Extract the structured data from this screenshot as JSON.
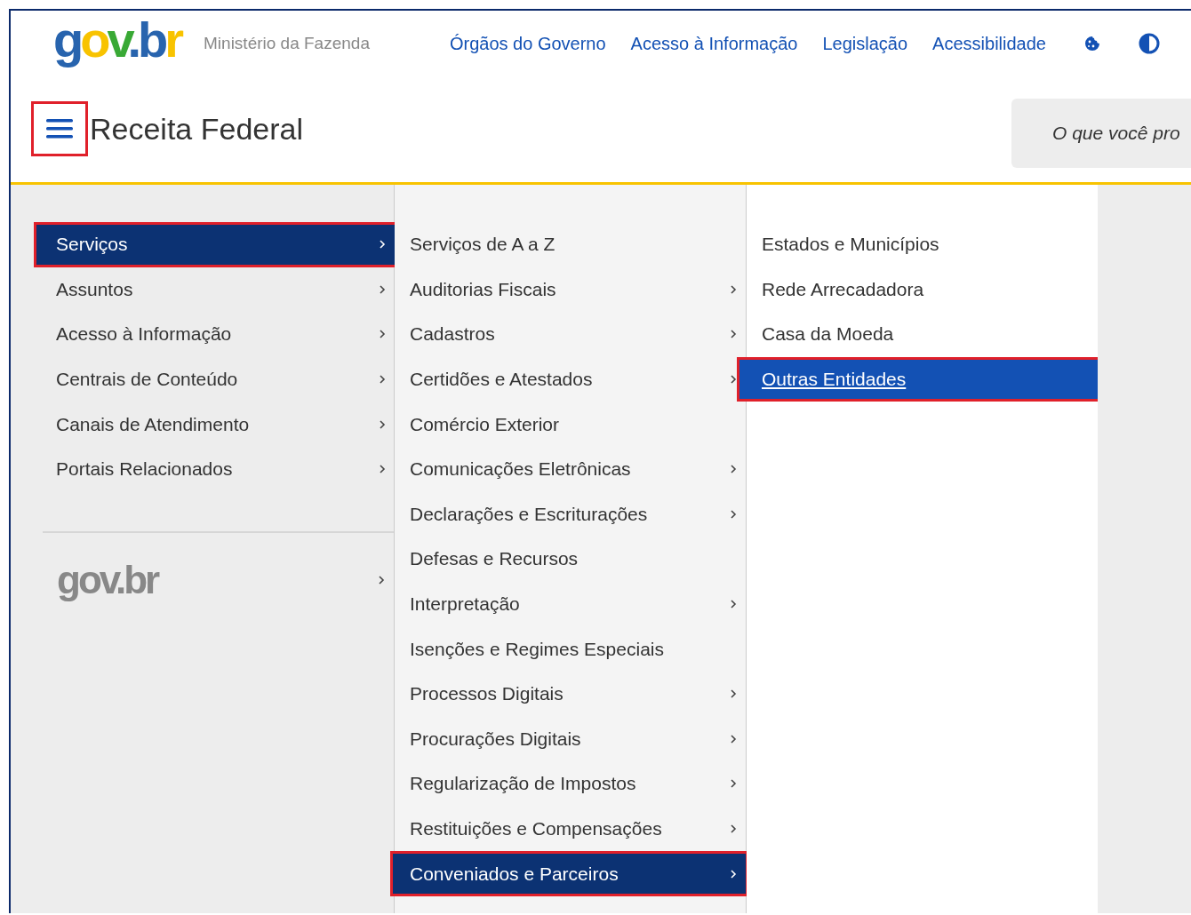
{
  "header": {
    "logo": "gov.br",
    "ministry": "Ministério da Fazenda",
    "nav_links": [
      "Órgãos do Governo",
      "Acesso à Informação",
      "Legislação",
      "Acessibilidade"
    ],
    "menu_button": {
      "highlighted": true
    },
    "site_title": "Receita Federal",
    "search": {
      "placeholder": "O que você pro"
    }
  },
  "menu_level_1": {
    "items": [
      {
        "label": "Serviços",
        "expandable": true,
        "selected": true,
        "highlighted": true
      },
      {
        "label": "Assuntos",
        "expandable": true,
        "selected": false,
        "highlighted": false
      },
      {
        "label": "Acesso à Informação",
        "expandable": true,
        "selected": false,
        "highlighted": false
      },
      {
        "label": "Centrais de Conteúdo",
        "expandable": true,
        "selected": false,
        "highlighted": false
      },
      {
        "label": "Canais de Atendimento",
        "expandable": true,
        "selected": false,
        "highlighted": false
      },
      {
        "label": "Portais Relacionados",
        "expandable": true,
        "selected": false,
        "highlighted": false
      }
    ],
    "footer_logo": "gov.br"
  },
  "menu_level_2": {
    "items": [
      {
        "label": "Serviços de A a Z",
        "expandable": false,
        "selected": false,
        "highlighted": false
      },
      {
        "label": "Auditorias Fiscais",
        "expandable": true,
        "selected": false,
        "highlighted": false
      },
      {
        "label": "Cadastros",
        "expandable": true,
        "selected": false,
        "highlighted": false
      },
      {
        "label": "Certidões e Atestados",
        "expandable": true,
        "selected": false,
        "highlighted": false
      },
      {
        "label": "Comércio Exterior",
        "expandable": false,
        "selected": false,
        "highlighted": false
      },
      {
        "label": "Comunicações Eletrônicas",
        "expandable": true,
        "selected": false,
        "highlighted": false
      },
      {
        "label": "Declarações e Escriturações",
        "expandable": true,
        "selected": false,
        "highlighted": false
      },
      {
        "label": "Defesas e Recursos",
        "expandable": false,
        "selected": false,
        "highlighted": false
      },
      {
        "label": "Interpretação",
        "expandable": true,
        "selected": false,
        "highlighted": false
      },
      {
        "label": "Isenções e Regimes Especiais",
        "expandable": false,
        "selected": false,
        "highlighted": false
      },
      {
        "label": "Processos Digitais",
        "expandable": true,
        "selected": false,
        "highlighted": false
      },
      {
        "label": "Procurações Digitais",
        "expandable": true,
        "selected": false,
        "highlighted": false
      },
      {
        "label": "Regularização de Impostos",
        "expandable": true,
        "selected": false,
        "highlighted": false
      },
      {
        "label": "Restituições e Compensações",
        "expandable": true,
        "selected": false,
        "highlighted": false
      },
      {
        "label": "Conveniados e Parceiros",
        "expandable": true,
        "selected": true,
        "highlighted": true
      }
    ]
  },
  "menu_level_3": {
    "items": [
      {
        "label": "Estados e Municípios",
        "selected": false,
        "highlighted": false
      },
      {
        "label": "Rede Arrecadadora",
        "selected": false,
        "highlighted": false
      },
      {
        "label": "Casa da Moeda",
        "selected": false,
        "highlighted": false
      },
      {
        "label": "Outras Entidades",
        "selected": true,
        "highlighted": true
      }
    ]
  }
}
